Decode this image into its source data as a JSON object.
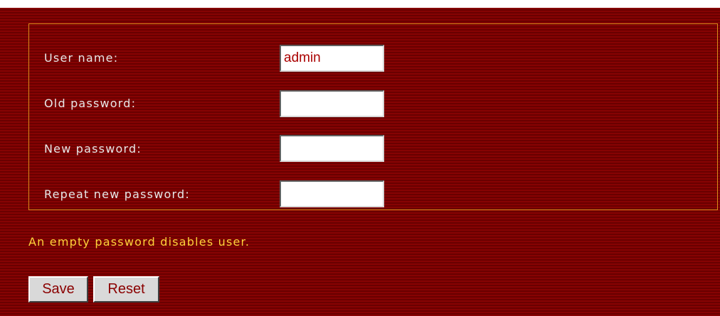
{
  "form": {
    "fields": [
      {
        "label": "User name:",
        "value": "admin",
        "type": "text"
      },
      {
        "label": "Old password:",
        "value": "",
        "type": "password"
      },
      {
        "label": "New password:",
        "value": "",
        "type": "password"
      },
      {
        "label": "Repeat new password:",
        "value": "",
        "type": "password"
      }
    ]
  },
  "note": "An empty password disables user.",
  "buttons": {
    "save_label": "Save",
    "reset_label": "Reset"
  },
  "colors": {
    "background": "#7a0000",
    "border": "#d98a1a",
    "label_text": "#e8e8e8",
    "note_text": "#ffd33a",
    "button_text": "#8a0000"
  }
}
